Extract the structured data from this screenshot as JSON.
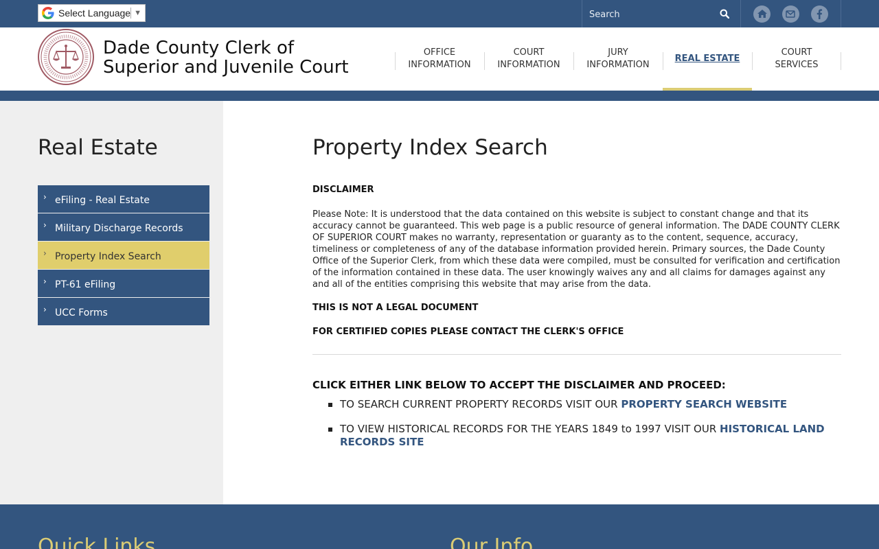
{
  "translate": {
    "label": "Select Language"
  },
  "search": {
    "placeholder": "Search"
  },
  "site": {
    "title_line1": "Dade County Clerk of",
    "title_line2": "Superior and Juvenile Court"
  },
  "nav": [
    {
      "label": "OFFICE\nINFORMATION"
    },
    {
      "label": "COURT\nINFORMATION"
    },
    {
      "label": "JURY\nINFORMATION"
    },
    {
      "label": "REAL ESTATE"
    },
    {
      "label": "COURT\nSERVICES"
    }
  ],
  "sidebar": {
    "title": "Real Estate",
    "items": [
      {
        "label": "eFiling - Real Estate"
      },
      {
        "label": "Military Discharge Records"
      },
      {
        "label": "Property Index Search"
      },
      {
        "label": "PT-61 eFiling"
      },
      {
        "label": "UCC Forms"
      }
    ]
  },
  "main": {
    "title": "Property Index Search",
    "disclaimer_heading": "DISCLAIMER",
    "disclaimer_text": "Please Note: It is understood that the data contained on this website is subject to constant change and that its accuracy cannot be guaranteed. This web page is a public resource of general information. The DADE COUNTY CLERK OF SUPERIOR COURT makes no warranty, representation or guaranty as to the content, sequence, accuracy, timeliness or completeness of any of the database information provided herein. Primary sources, the Dade County Office of the Superior Clerk, from which these data were compiled, must be consulted for verification and certification of the information contained in these data. The user knowingly waives any and all claims for damages against any and all of the entities comprising this website that may arise from the data.",
    "not_legal": "THIS IS NOT A LEGAL DOCUMENT",
    "certified": "FOR CERTIFIED COPIES PLEASE CONTACT THE CLERK'S OFFICE",
    "click_heading": "CLICK EITHER LINK BELOW TO ACCEPT THE DISCLAIMER AND PROCEED:",
    "links": [
      {
        "text": "TO SEARCH CURRENT PROPERTY RECORDS VISIT OUR ",
        "link": "PROPERTY SEARCH WEBSITE"
      },
      {
        "text": "TO VIEW HISTORICAL RECORDS FOR THE YEARS 1849 to 1997 VISIT OUR ",
        "link": "HISTORICAL LAND RECORDS SITE"
      }
    ]
  },
  "footer": {
    "left_heading": "Quick Links",
    "right_heading": "Our Info"
  },
  "colors": {
    "primary": "#33557f",
    "accent": "#dbcc74",
    "sidebar_bg": "#efefef",
    "seal": "#a05a64"
  },
  "icons": {
    "home": "home-icon",
    "mail": "mail-icon",
    "facebook": "facebook-icon",
    "search": "search-icon"
  }
}
